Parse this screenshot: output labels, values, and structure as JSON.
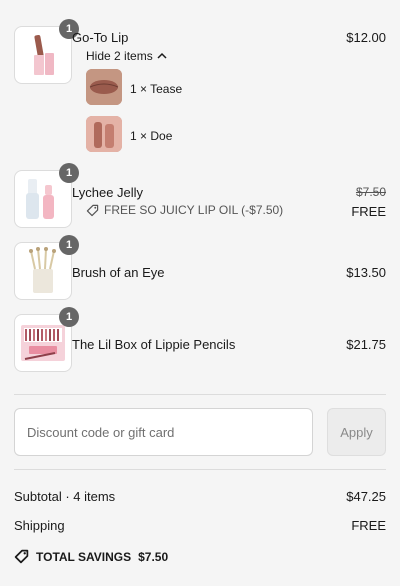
{
  "cart": {
    "items": [
      {
        "name": "Go-To Lip",
        "price": "$12.00",
        "quantity": "1",
        "toggle_label": "Hide 2 items",
        "toggle_icon": "chevron-up-icon",
        "sub_items": [
          {
            "label": "1 × Tease",
            "image": "lip-tease-swatch"
          },
          {
            "label": "1 × Doe",
            "image": "lip-doe-swatch"
          }
        ]
      },
      {
        "name": "Lychee Jelly",
        "original_price": "$7.50",
        "price": "FREE",
        "quantity": "1",
        "promo_label": "FREE SO JUICY LIP OIL (-$7.50)",
        "promo_icon": "tag-icon"
      },
      {
        "name": "Brush of an Eye",
        "price": "$13.50",
        "quantity": "1"
      },
      {
        "name": "The Lil Box of Lippie Pencils",
        "price": "$21.75",
        "quantity": "1"
      }
    ]
  },
  "discount": {
    "placeholder": "Discount code or gift card",
    "value": "",
    "apply_label": "Apply"
  },
  "summary": {
    "subtotal_label": "Subtotal · 4 items",
    "subtotal_value": "$47.25",
    "shipping_label": "Shipping",
    "shipping_value": "FREE",
    "savings_label": "TOTAL SAVINGS",
    "savings_value": "$7.50",
    "savings_icon": "tag-icon"
  },
  "colors": {
    "background": "#f5f5f5",
    "badge": "#666666",
    "divider": "#dcdcdc",
    "text": "#1a1a1a",
    "muted_text": "#555555"
  }
}
